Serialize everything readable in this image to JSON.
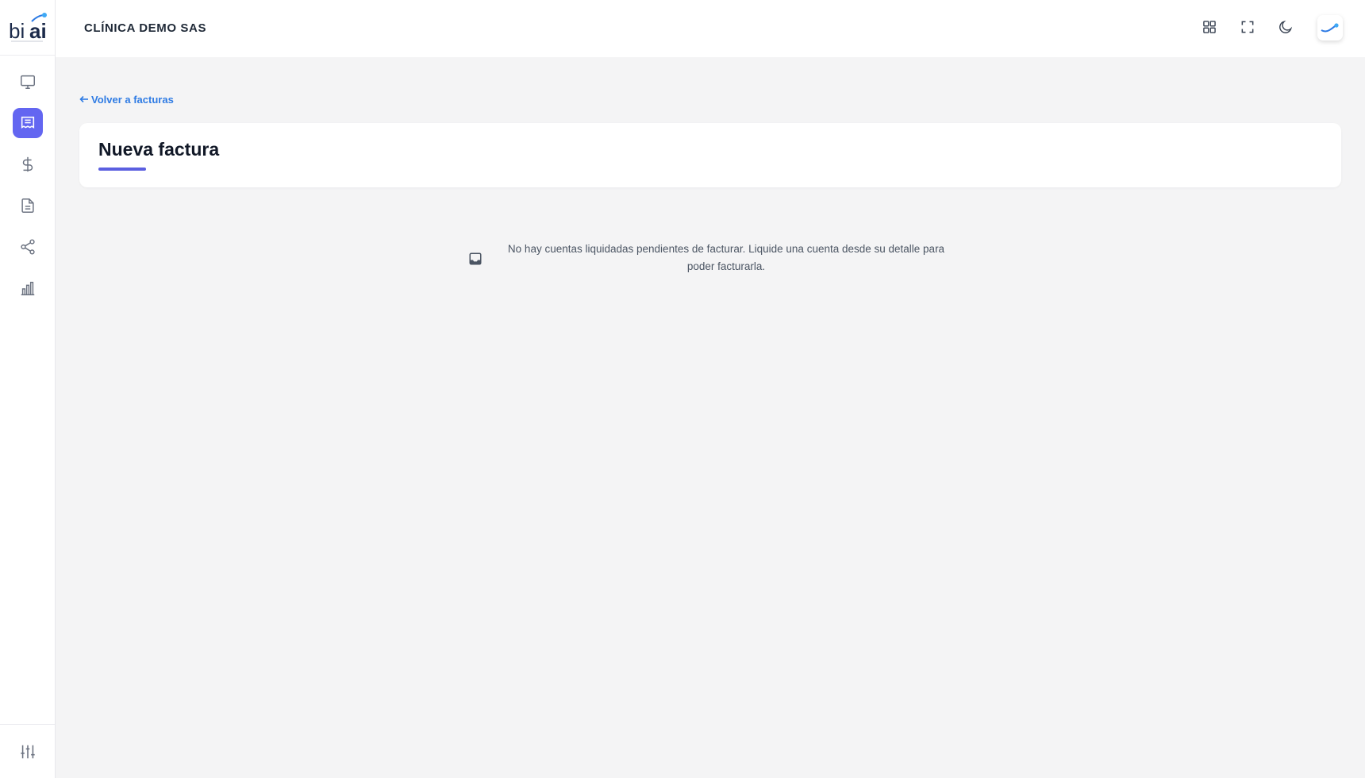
{
  "app": {
    "logo_text": "biai",
    "clinic_name": "CLÍNICA DEMO SAS",
    "accent_color": "#6366f1",
    "link_color": "#2e7be4"
  },
  "sidebar": {
    "items": [
      {
        "icon": "monitor-icon",
        "active": false
      },
      {
        "icon": "receipt-icon",
        "active": true
      },
      {
        "icon": "dollar-icon",
        "active": false
      },
      {
        "icon": "document-icon",
        "active": false
      },
      {
        "icon": "share-icon",
        "active": false
      },
      {
        "icon": "bar-chart-icon",
        "active": false
      }
    ],
    "bottom_icon": "sliders-icon"
  },
  "topbar": {
    "icons": [
      "grid-icon",
      "fullscreen-icon",
      "moon-icon",
      "avatar-logo"
    ]
  },
  "page": {
    "back_link": "Volver a facturas",
    "title": "Nueva factura",
    "empty_message": "No hay cuentas liquidadas pendientes de facturar. Liquide una cuenta desde su detalle para poder facturarla.",
    "empty_icon": "inbox-icon"
  }
}
